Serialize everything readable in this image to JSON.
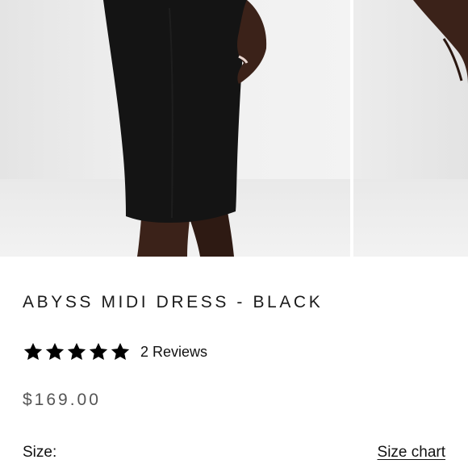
{
  "product": {
    "name": "ABYSS MIDI DRESS - BLACK",
    "rating": 5,
    "rating_max": 5,
    "reviews_label": "2 Reviews",
    "price": "$169.00"
  },
  "size": {
    "label": "Size:",
    "chart_link": "Size chart"
  },
  "colors": {
    "dress": "#141414",
    "skin": "#3b2219",
    "star": "#000000",
    "price_text": "#555555"
  },
  "icons": {
    "rating": "star-icon"
  }
}
